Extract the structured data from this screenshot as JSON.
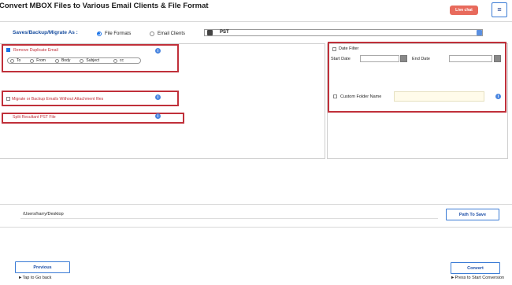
{
  "header": {
    "title": "Convert MBOX Files to Various Email Clients & File Format",
    "live_chat": "Live chat",
    "menu_glyph": "≡"
  },
  "saves": {
    "label": "Saves/Backup/Migrate As :",
    "option_file_formats": "File Formats",
    "option_email_clients": "Email Clients",
    "selected_option": "File Formats",
    "format_value": "PST"
  },
  "left_options": {
    "remove_duplicate": {
      "label": "Remove Duplicate Email",
      "checked": true,
      "fields": [
        "To",
        "From",
        "Body",
        "Subject",
        "cc"
      ]
    },
    "migrate_without_attachment": {
      "label": "Migrate or Backup Emails Without Attachment files",
      "checked": false
    },
    "split_pst": {
      "label": "Split Resultant PST File"
    }
  },
  "right_options": {
    "date_filter": {
      "label": "Date Filter",
      "checked": false,
      "start_label": "Start Date",
      "end_label": "End Date"
    },
    "custom_folder": {
      "label": "Custom Folder Name",
      "checked": false,
      "value": ""
    }
  },
  "destination": {
    "path": "/Users/harry/Desktop",
    "path_button": "Path To Save"
  },
  "footer": {
    "previous_button": "Previous",
    "previous_hint": "►Tap to Go back",
    "convert_button": "Convert",
    "convert_hint": "►Press to Start Conversion"
  },
  "colors": {
    "accent_blue": "#1a4fa0",
    "highlight_red": "#c0303a",
    "live_chat_bg": "#e86a5c"
  }
}
